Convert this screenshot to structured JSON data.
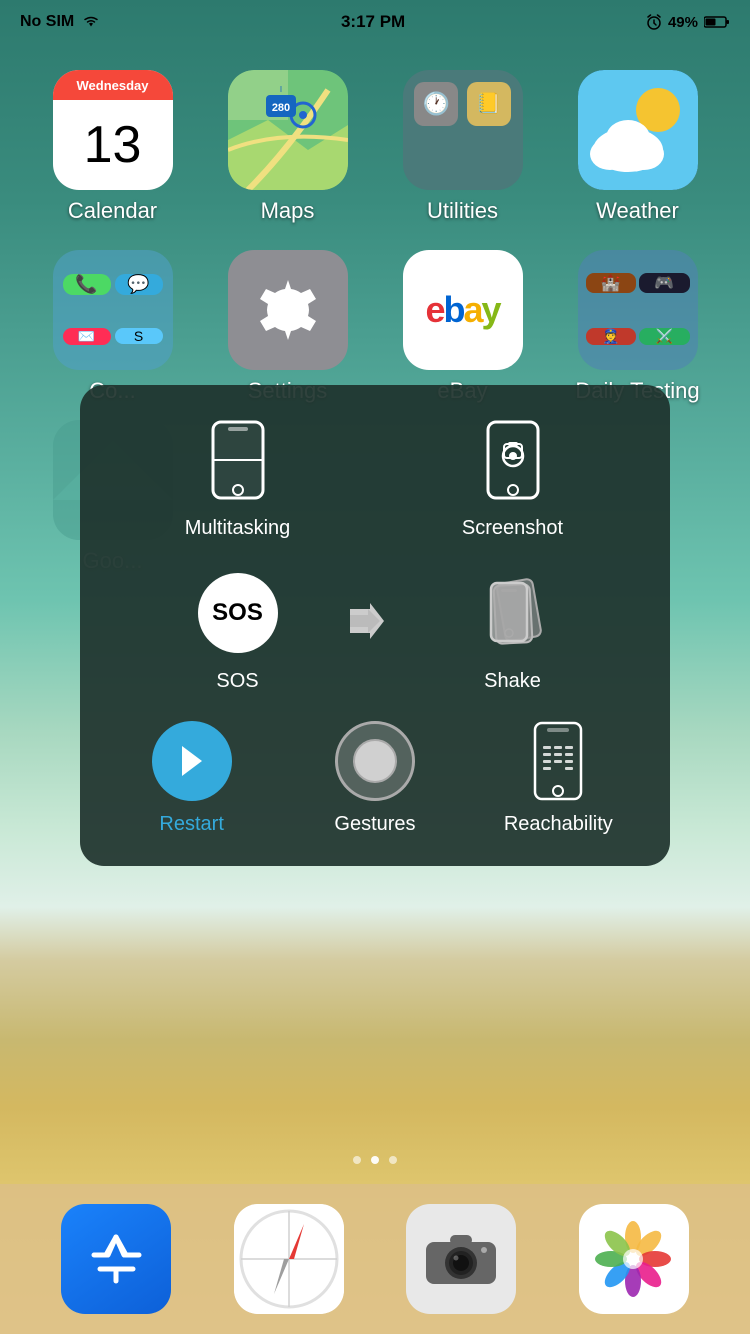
{
  "statusBar": {
    "carrier": "No SIM",
    "time": "3:17 PM",
    "battery": "49%",
    "alarm": true
  },
  "apps": {
    "row1": [
      {
        "id": "calendar",
        "label": "Calendar",
        "day": "13",
        "weekday": "Wednesday"
      },
      {
        "id": "maps",
        "label": "Maps"
      },
      {
        "id": "utilities",
        "label": "Utilities"
      },
      {
        "id": "weather",
        "label": "Weather"
      }
    ],
    "row2": [
      {
        "id": "comms-folder",
        "label": "Co...",
        "type": "folder"
      },
      {
        "id": "settings",
        "label": "Settings"
      },
      {
        "id": "ebay",
        "label": "eBay"
      },
      {
        "id": "gaming-folder",
        "label": "Daily Testing",
        "type": "folder"
      }
    ],
    "row3partial": [
      {
        "id": "google-folder",
        "label": "Goo..."
      },
      {
        "id": "blank",
        "label": ""
      }
    ]
  },
  "assistiveTouch": {
    "items": [
      {
        "id": "multitasking",
        "label": "Multitasking"
      },
      {
        "id": "screenshot",
        "label": "Screenshot"
      },
      {
        "id": "sos",
        "label": "SOS"
      },
      {
        "id": "shake",
        "label": "Shake"
      },
      {
        "id": "restart",
        "label": "Restart"
      },
      {
        "id": "gestures",
        "label": "Gestures"
      },
      {
        "id": "reachability",
        "label": "Reachability"
      }
    ]
  },
  "dock": [
    {
      "id": "app-store",
      "label": "App Store"
    },
    {
      "id": "safari",
      "label": "Safari"
    },
    {
      "id": "camera",
      "label": "Camera"
    },
    {
      "id": "photos",
      "label": "Photos"
    }
  ],
  "pageDots": [
    0,
    1,
    2
  ],
  "activeDot": 1
}
